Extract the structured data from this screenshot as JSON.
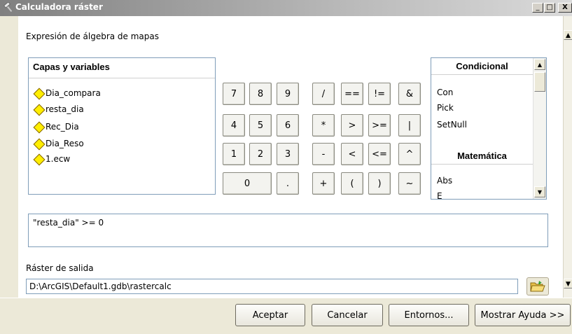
{
  "window": {
    "title": "Calculadora ráster",
    "minimize_label": "_",
    "maximize_label": "□",
    "close_label": "X"
  },
  "section_label": "Expresión de álgebra de mapas",
  "layers": {
    "header": "Capas y variables",
    "items": [
      "Dia_compara",
      "resta_dia",
      "Rec_Dia",
      "Dia_Reso",
      "1.ecw"
    ]
  },
  "keypad": {
    "row1": [
      "7",
      "8",
      "9",
      "/",
      "==",
      "!=",
      "&"
    ],
    "row2": [
      "4",
      "5",
      "6",
      "*",
      ">",
      ">=",
      "|"
    ],
    "row3": [
      "1",
      "2",
      "3",
      "-",
      "<",
      "<=",
      "^"
    ],
    "row4": [
      "0",
      ".",
      "+",
      "(",
      ")",
      "~"
    ]
  },
  "functions": {
    "conditional_header": "Condicional",
    "conditional_items": [
      "Con",
      "Pick",
      "SetNull"
    ],
    "math_header": "Matemática",
    "math_items": [
      "Abs",
      "E"
    ]
  },
  "expression": "\"resta_dia\" >= 0",
  "output": {
    "label": "Ráster de salida",
    "value": "D:\\ArcGIS\\Default1.gdb\\rastercalc"
  },
  "buttons": {
    "ok": "Aceptar",
    "cancel": "Cancelar",
    "environments": "Entornos...",
    "help": "Mostrar Ayuda >>"
  },
  "colors": {
    "layer_diamond": "#ffee00",
    "panel_border": "#7f9db9",
    "dialog_bg": "#ece9d8"
  }
}
